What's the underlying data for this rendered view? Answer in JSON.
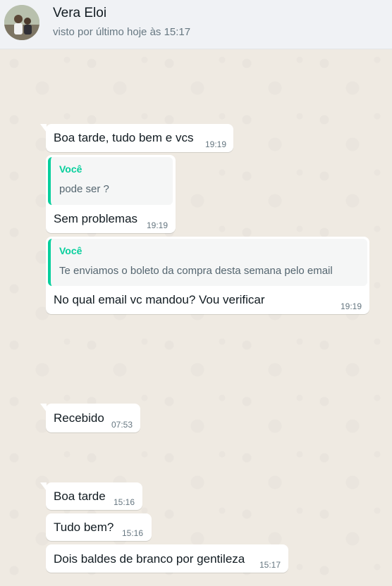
{
  "header": {
    "contact_name": "Vera Eloi",
    "status": "visto por último hoje às 15:17"
  },
  "messages": [
    {
      "text": "Boa tarde, tudo bem e vcs",
      "time": "19:19"
    },
    {
      "quote": {
        "author": "Você",
        "text": "pode ser ?"
      },
      "text": "Sem problemas",
      "time": "19:19"
    },
    {
      "quote": {
        "author": "Você",
        "text": "Te enviamos o boleto da compra desta semana pelo email"
      },
      "text": "No qual email vc mandou? Vou verificar",
      "time": "19:19"
    },
    {
      "text": "Recebido",
      "time": "07:53"
    },
    {
      "text": "Boa tarde",
      "time": "15:16"
    },
    {
      "text": "Tudo bem?",
      "time": "15:16"
    },
    {
      "text": "Dois baldes de branco por gentileza",
      "time": "15:17"
    }
  ],
  "colors": {
    "chat_background": "#efeae2",
    "header_background": "#f0f2f5",
    "bubble": "#ffffff",
    "quote_accent": "#06cf9c"
  }
}
